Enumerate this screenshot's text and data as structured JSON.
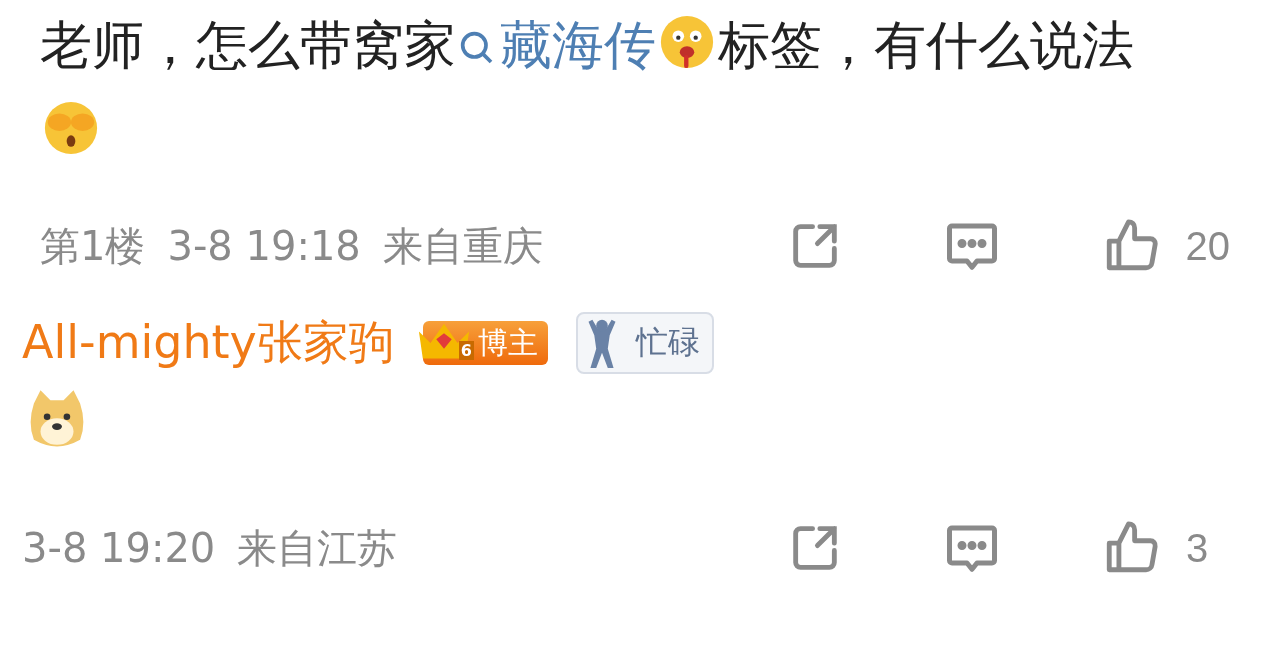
{
  "comments": [
    {
      "segments": [
        {
          "kind": "text",
          "text": "老师，怎么带窝家"
        },
        {
          "kind": "topic",
          "text": "藏海传"
        },
        {
          "kind": "drool"
        },
        {
          "kind": "text",
          "text": "标签，有什么说法"
        },
        {
          "kind": "shy"
        }
      ],
      "meta": {
        "floor": "第1楼",
        "time": "3-8 19:18",
        "location": "来自重庆",
        "likes": "20"
      }
    },
    {
      "author": "All-mighty张家驹",
      "badges": [
        {
          "kind": "blogger",
          "level": "6",
          "label": "博主"
        },
        {
          "kind": "status",
          "label": "忙碌"
        }
      ],
      "segments": [
        {
          "kind": "doge"
        }
      ],
      "meta": {
        "time": "3-8 19:20",
        "location": "来自江苏",
        "likes": "3"
      }
    }
  ]
}
